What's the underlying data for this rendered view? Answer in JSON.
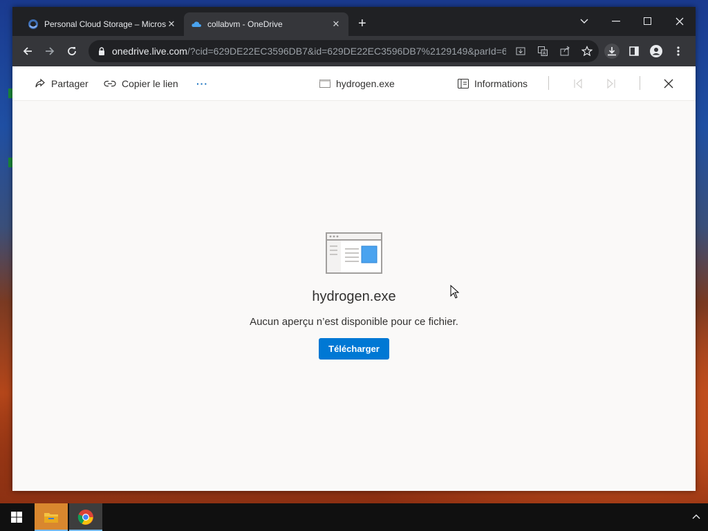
{
  "browser": {
    "tabs": [
      {
        "title": "Personal Cloud Storage – Microsoft",
        "icon": "onedrive-edge-icon",
        "active": false
      },
      {
        "title": "collabvm - OneDrive",
        "icon": "onedrive-cloud-icon",
        "active": true
      }
    ],
    "url_host": "onedrive.live.com",
    "url_rest": "/?cid=629DE22EC3596DB7&id=629DE22EC3596DB7%2129149&parId=6..."
  },
  "commandbar": {
    "share_label": "Partager",
    "copy_link_label": "Copier le lien",
    "more_label": "···",
    "file_title": "hydrogen.exe",
    "info_label": "Informations"
  },
  "preview": {
    "file_name": "hydrogen.exe",
    "message": "Aucun aperçu n’est disponible pour ce fichier.",
    "download_label": "Télécharger"
  },
  "colors": {
    "accent": "#0078d4",
    "chrome_dark": "#202124",
    "chrome_toolbar": "#35363a"
  }
}
